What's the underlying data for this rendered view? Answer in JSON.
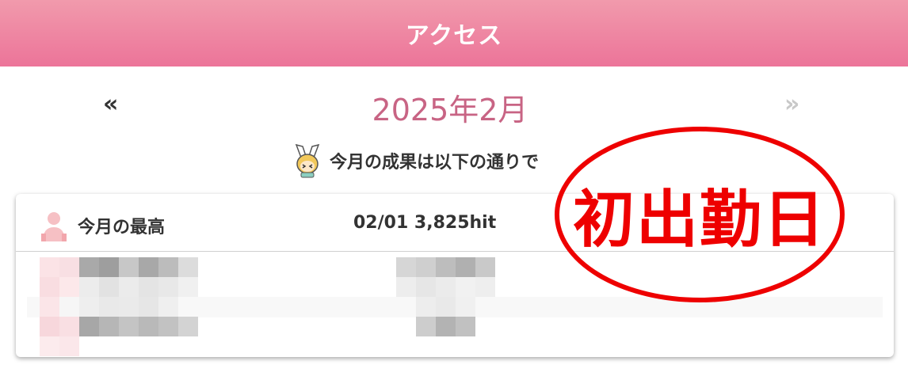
{
  "header": {
    "title": "アクセス"
  },
  "month_nav": {
    "prev_label": "«",
    "current_month": "2025年2月",
    "next_label": "»"
  },
  "results": {
    "message": "今月の成果は以下の通りで"
  },
  "best": {
    "label": "今月の最高",
    "value": "02/01 3,825hit"
  },
  "annotation": {
    "text": "初出勤日",
    "color": "#ee0000"
  },
  "colors": {
    "header_gradient_top": "#f19aac",
    "header_gradient_bottom": "#ec7499",
    "month_accent": "#c86484",
    "nav_disabled": "#c8c8c8"
  },
  "icons": {
    "mascot": "bunny-ear-mascot-icon",
    "best": "person-silhouette-icon"
  }
}
